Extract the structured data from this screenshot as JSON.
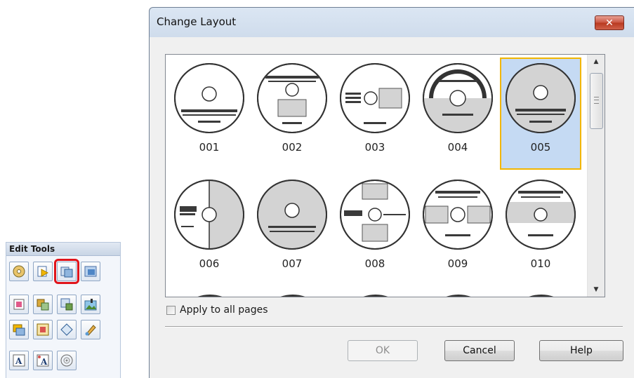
{
  "edit_tools": {
    "title": "Edit Tools",
    "rows": [
      [
        {
          "name": "disc-tool-icon",
          "active": false
        },
        {
          "name": "page-tool-icon",
          "active": false
        },
        {
          "name": "change-layout-icon",
          "active": true
        },
        {
          "name": "background-tool-icon",
          "active": false
        }
      ],
      [
        {
          "name": "fill-tool-icon",
          "active": false
        },
        {
          "name": "image-tool-icon",
          "active": false
        },
        {
          "name": "frame-tool-icon",
          "active": false
        },
        {
          "name": "photo-tool-icon",
          "active": false
        }
      ],
      [
        {
          "name": "arrange-tool-icon",
          "active": false
        },
        {
          "name": "trim-tool-icon",
          "active": false
        },
        {
          "name": "shape-tool-icon",
          "active": false
        },
        {
          "name": "paint-tool-icon",
          "active": false
        }
      ],
      [
        {
          "name": "text-tool-icon",
          "active": false
        },
        {
          "name": "text-edit-tool-icon",
          "active": false
        },
        {
          "name": "disc-label-tool-icon",
          "active": false
        }
      ]
    ]
  },
  "dialog": {
    "title": "Change Layout",
    "close_glyph": "✕",
    "layouts": [
      {
        "label": "001",
        "selected": false
      },
      {
        "label": "002",
        "selected": false
      },
      {
        "label": "003",
        "selected": false
      },
      {
        "label": "004",
        "selected": false
      },
      {
        "label": "005",
        "selected": true
      },
      {
        "label": "006",
        "selected": false
      },
      {
        "label": "007",
        "selected": false
      },
      {
        "label": "008",
        "selected": false
      },
      {
        "label": "009",
        "selected": false
      },
      {
        "label": "010",
        "selected": false
      }
    ],
    "scroll_up_glyph": "▲",
    "scroll_down_glyph": "▼",
    "apply_all_label": "Apply to all pages",
    "apply_all_checked": false,
    "ok_label": "OK",
    "ok_enabled": false,
    "cancel_label": "Cancel",
    "help_label": "Help"
  },
  "colors": {
    "selection_border": "#f2b600",
    "selection_fill": "#c5daf3",
    "highlight_box": "#e0141b"
  }
}
